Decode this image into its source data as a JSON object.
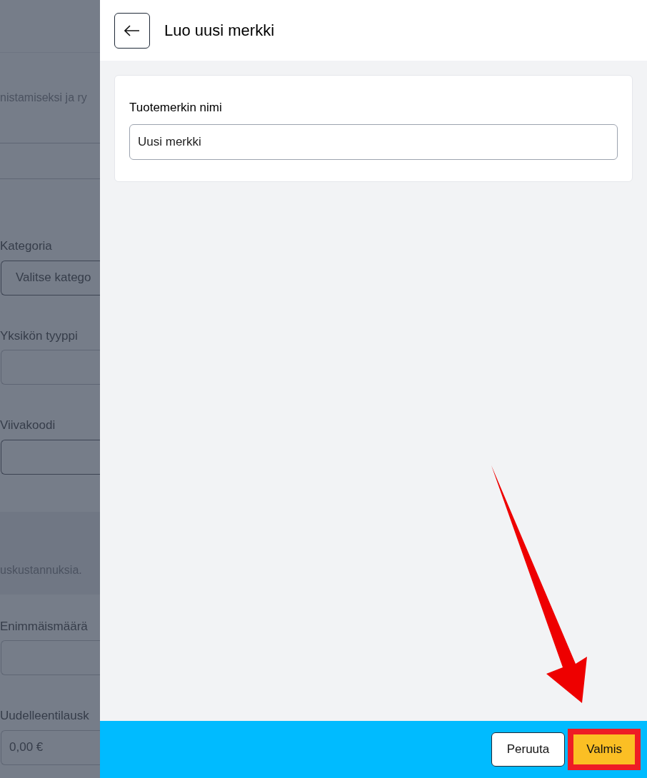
{
  "background_form": {
    "items": [
      {
        "kind": "help",
        "text": "nistamiseksi ja ry"
      },
      {
        "kind": "row"
      },
      {
        "kind": "row"
      },
      {
        "kind": "field",
        "label": "Kategoria",
        "value": "Valitse katego",
        "select": true
      },
      {
        "kind": "field",
        "label": "Yksikön tyyppi"
      },
      {
        "kind": "field",
        "label": "Viivakoodi",
        "select": true
      },
      {
        "kind": "band",
        "text": "uskustannuksia."
      },
      {
        "kind": "field",
        "label": "Enimmäismäärä"
      },
      {
        "kind": "field",
        "label": "Uudelleentilausk",
        "value": "0,00 €"
      }
    ]
  },
  "panel": {
    "title": "Luo uusi merkki",
    "field": {
      "label": "Tuotemerkin nimi",
      "value": "Uusi merkki"
    }
  },
  "footer": {
    "buttons": [
      {
        "label": "Peruuta",
        "kind": "secondary",
        "highlighted": false
      },
      {
        "label": "Valmis",
        "kind": "primary",
        "highlighted": true
      }
    ]
  },
  "annotation_arrow": true
}
